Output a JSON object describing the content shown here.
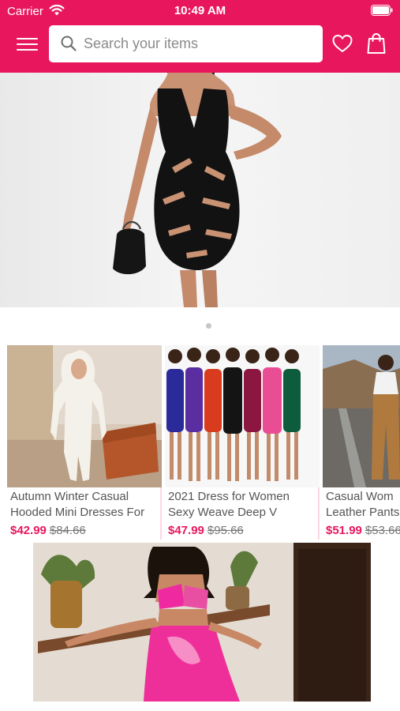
{
  "status_bar": {
    "carrier": "Carrier",
    "time": "10:49 AM",
    "wifi_icon": "wifi-icon",
    "battery_icon": "battery-icon"
  },
  "header": {
    "background_color": "#e8175d",
    "menu_icon": "hamburger-menu-icon",
    "search_placeholder": "Search your items",
    "search_value": "",
    "wishlist_icon": "heart-icon",
    "cart_icon": "shopping-bag-icon"
  },
  "hero_banner": {
    "image": "model in black bandage cut-out dress",
    "page_indicator_count": 1,
    "active_page": 1
  },
  "products": [
    {
      "title": "Autumn Winter Casual\nHooded Mini Dresses For",
      "price": "$42.99",
      "original_price": "$84.66",
      "image": "white hooded bodycon mini dress"
    },
    {
      "title": "2021 Dress for Women\nSexy Weave Deep V",
      "price": "$47.99",
      "original_price": "$95.66",
      "image": "bandage dress in seven colors"
    },
    {
      "title": "Casual Wom\nLeather Pants",
      "price": "$51.99",
      "original_price": "$53.66",
      "image": "tan leather pants outfit"
    }
  ],
  "promo_banner": {
    "image": "pink tie-dye bikini top and flared pants set"
  },
  "colors": {
    "accent": "#e8175d",
    "sale_price": "#e8175d",
    "card_divider": "#ffd6e4"
  }
}
